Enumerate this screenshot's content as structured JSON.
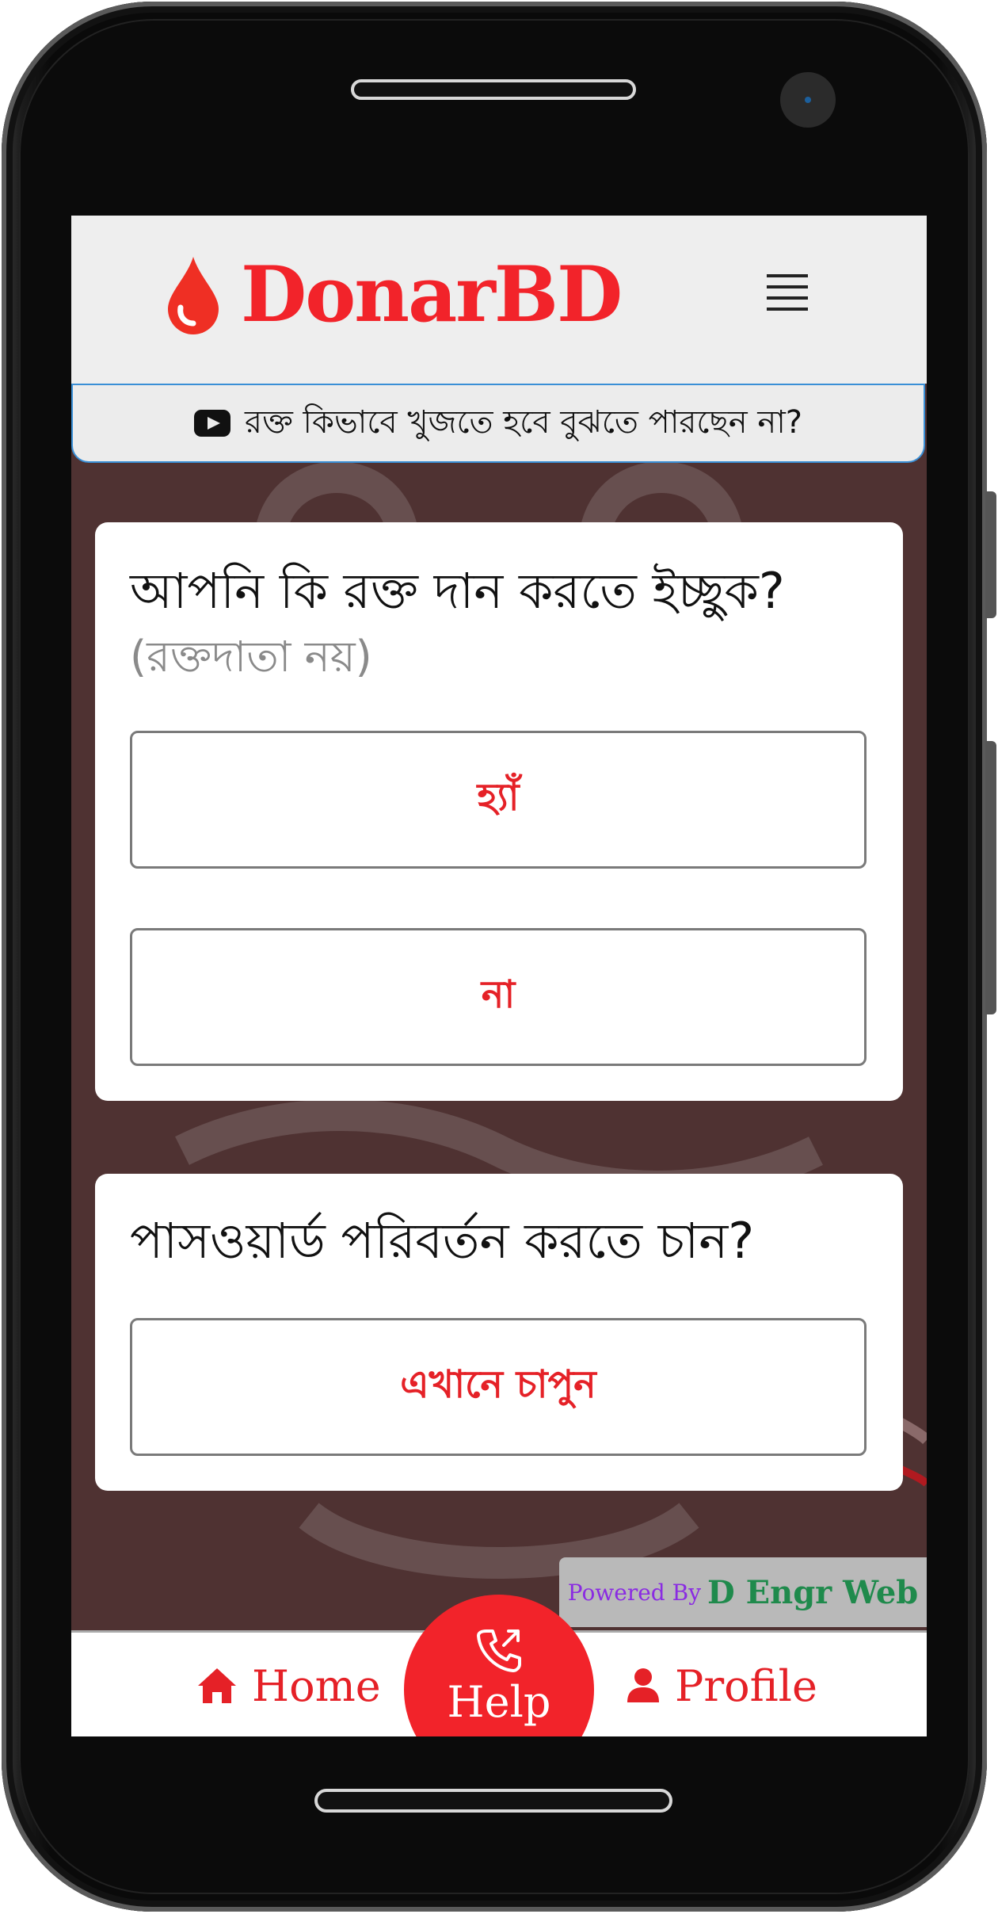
{
  "header": {
    "brand_name": "DonarBD"
  },
  "banner": {
    "text": "রক্ত কিভাবে খুজতে হবে বুঝতে পারছেন না?"
  },
  "donate_card": {
    "question": "আপনি কি রক্ত দান করতে ইচ্ছুক?",
    "subtitle": "(রক্তদাতা নয়)",
    "yes_label": "হ্যাঁ",
    "no_label": "না"
  },
  "password_card": {
    "question": "পাসওয়ার্ড পরিবর্তন করতে চান?",
    "action_label": "এখানে চাপুন"
  },
  "powered_by": {
    "prefix": "Powered By",
    "name": "D Engr Web"
  },
  "bottom_nav": {
    "home_label": "Home",
    "help_label": "Help",
    "profile_label": "Profile"
  },
  "colors": {
    "brand_red": "#f2232a",
    "overlay_bg": "#4f3232",
    "powered_prefix": "#8a2be2",
    "powered_name": "#1f8a4c"
  },
  "icons": [
    "blood-drop-icon",
    "hamburger-menu-icon",
    "youtube-icon",
    "home-icon",
    "phone-call-icon",
    "user-icon"
  ]
}
